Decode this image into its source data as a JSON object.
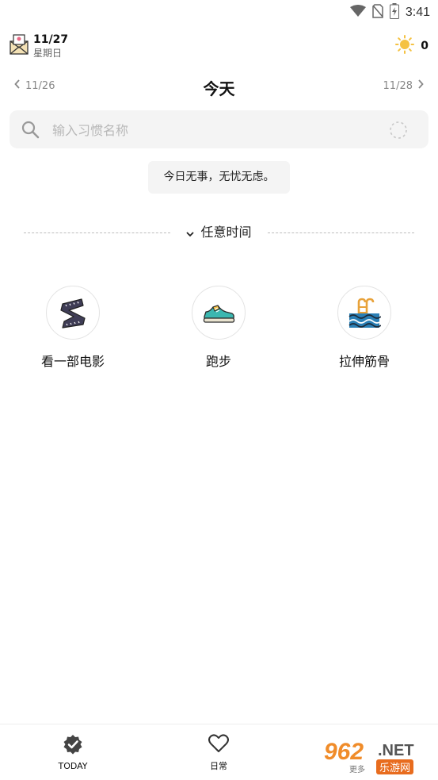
{
  "status_bar": {
    "time": "3:41",
    "icons": [
      "wifi-icon",
      "no-sim-icon",
      "battery-charging-icon"
    ]
  },
  "header": {
    "date": "11/27",
    "weekday": "星期日",
    "mail_icon": "mail-icon",
    "sun_icon": "sun-icon",
    "sun_count": "0"
  },
  "navigation": {
    "prev_date": "11/26",
    "title": "今天",
    "next_date": "11/28"
  },
  "search": {
    "placeholder": "输入习惯名称",
    "value": ""
  },
  "tip": "今日无事，无忧无虑。",
  "section": {
    "label": "任意时间"
  },
  "habits": [
    {
      "name": "看一部电影",
      "icon": "film-strip-icon"
    },
    {
      "name": "跑步",
      "icon": "sneaker-icon"
    },
    {
      "name": "拉伸筋骨",
      "icon": "pool-ladder-icon"
    }
  ],
  "tabs": [
    {
      "label": "TODAY",
      "icon": "check-badge-icon"
    },
    {
      "label": "日常",
      "icon": "heart-icon"
    }
  ],
  "watermark": {
    "logo": "962",
    "domain": ".NET",
    "site": "乐游网",
    "more": "更多"
  },
  "colors": {
    "accent_orange": "#f08c2a",
    "sun_yellow": "#f5c242",
    "pool_blue": "#2a7fb5",
    "shoe_teal": "#3bb7b0"
  }
}
